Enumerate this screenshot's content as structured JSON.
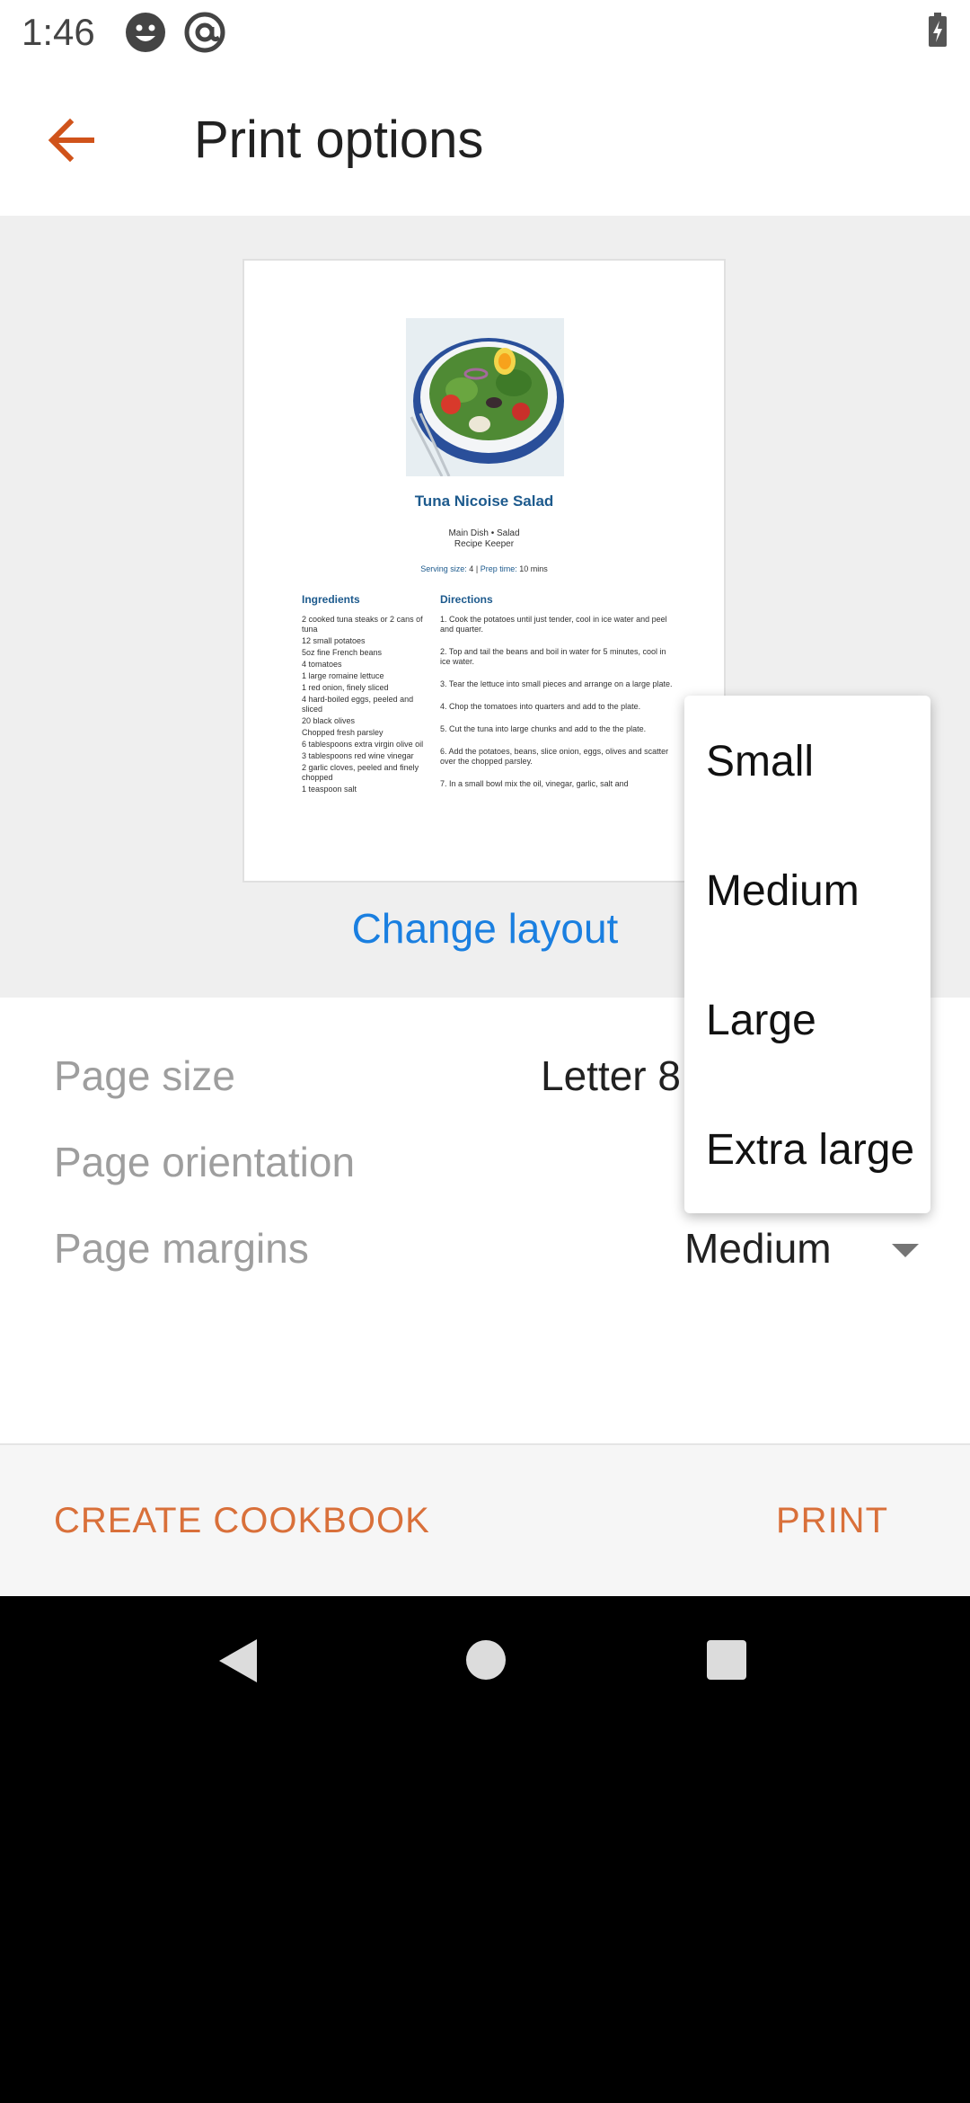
{
  "status_bar": {
    "time": "1:46",
    "icons": [
      "face-icon",
      "at-sign-icon",
      "battery-charging-icon"
    ]
  },
  "app_bar": {
    "title": "Print options",
    "back_icon": "arrow-back-icon"
  },
  "preview": {
    "recipe_title": "Tuna Nicoise Salad",
    "category": "Main Dish • Salad",
    "source": "Recipe Keeper",
    "serving_label": "Serving size:",
    "serving_value": "4",
    "separator": "|",
    "prep_label": "Prep time:",
    "prep_value": "10 mins",
    "ingredients_heading": "Ingredients",
    "directions_heading": "Directions",
    "ingredients": [
      "2 cooked tuna steaks or 2 cans of tuna",
      "12 small potatoes",
      "5oz fine French beans",
      "4 tomatoes",
      "1 large romaine lettuce",
      "1 red onion, finely sliced",
      "4 hard-boiled eggs, peeled and sliced",
      "20 black olives",
      "Chopped fresh parsley",
      "6 tablespoons extra virgin olive oil",
      "3 tablespoons red wine vinegar",
      "2 garlic cloves, peeled and finely chopped",
      "1 teaspoon salt"
    ],
    "directions": [
      "1. Cook the potatoes until just tender, cool in ice water and peel and quarter.",
      "2. Top and tail the beans and boil in water for 5 minutes, cool in ice water.",
      "3. Tear the lettuce into small pieces and arrange on a large plate.",
      "4. Chop the tomatoes into quarters and add to the plate.",
      "5. Cut the tuna into large chunks and add to the the plate.",
      "6. Add the potatoes, beans, slice onion, eggs, olives and scatter over the chopped parsley.",
      "7. In a small bowl mix the oil, vinegar, garlic, salt and"
    ]
  },
  "change_layout_label": "Change layout",
  "settings": {
    "page_size_label": "Page size",
    "page_size_value": "Letter 8",
    "page_orientation_label": "Page orientation",
    "page_margins_label": "Page margins",
    "page_margins_value": "Medium"
  },
  "dropdown": {
    "options": [
      "Small",
      "Medium",
      "Large",
      "Extra large"
    ]
  },
  "actions": {
    "create_cookbook": "CREATE COOKBOOK",
    "print": "PRINT"
  },
  "nav_bar": {
    "icons": [
      "nav-back-icon",
      "nav-home-icon",
      "nav-recents-icon"
    ]
  },
  "colors": {
    "accent": "#d9703a",
    "link": "#1a7fe0",
    "recipe_title": "#1d5a8d"
  }
}
